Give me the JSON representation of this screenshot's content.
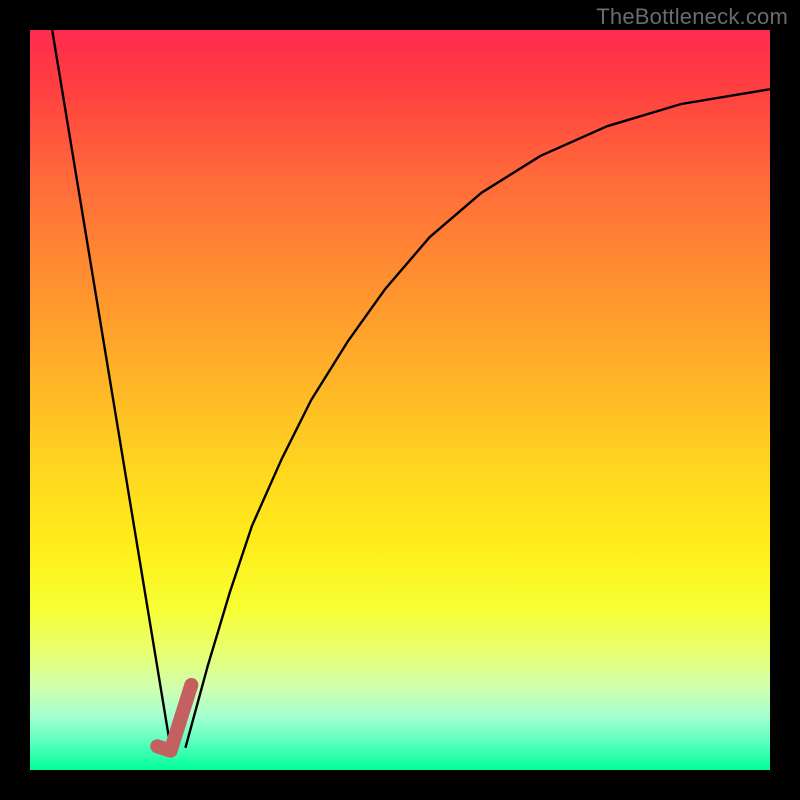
{
  "watermark": "TheBottleneck.com",
  "chart_data": {
    "type": "line",
    "title": "",
    "xlabel": "",
    "ylabel": "",
    "xlim": [
      0,
      100
    ],
    "ylim": [
      0,
      100
    ],
    "grid": false,
    "legend": false,
    "series": [
      {
        "name": "left-linear-descent",
        "stroke": "#000000",
        "stroke_width": 2.4,
        "x": [
          3,
          19
        ],
        "values": [
          100,
          3
        ]
      },
      {
        "name": "right-log-ascent",
        "stroke": "#000000",
        "stroke_width": 2.4,
        "x": [
          21,
          24,
          27,
          30,
          34,
          38,
          43,
          48,
          54,
          61,
          69,
          78,
          88,
          100
        ],
        "values": [
          3,
          14,
          24,
          33,
          42,
          50,
          58,
          65,
          72,
          78,
          83,
          87,
          90,
          92
        ]
      },
      {
        "name": "bottom-hook-marker",
        "stroke": "#c46060",
        "stroke_width": 14,
        "linecap": "round",
        "x": [
          17.2,
          19.0,
          21.8
        ],
        "values": [
          3.2,
          2.6,
          11.5
        ]
      }
    ]
  }
}
